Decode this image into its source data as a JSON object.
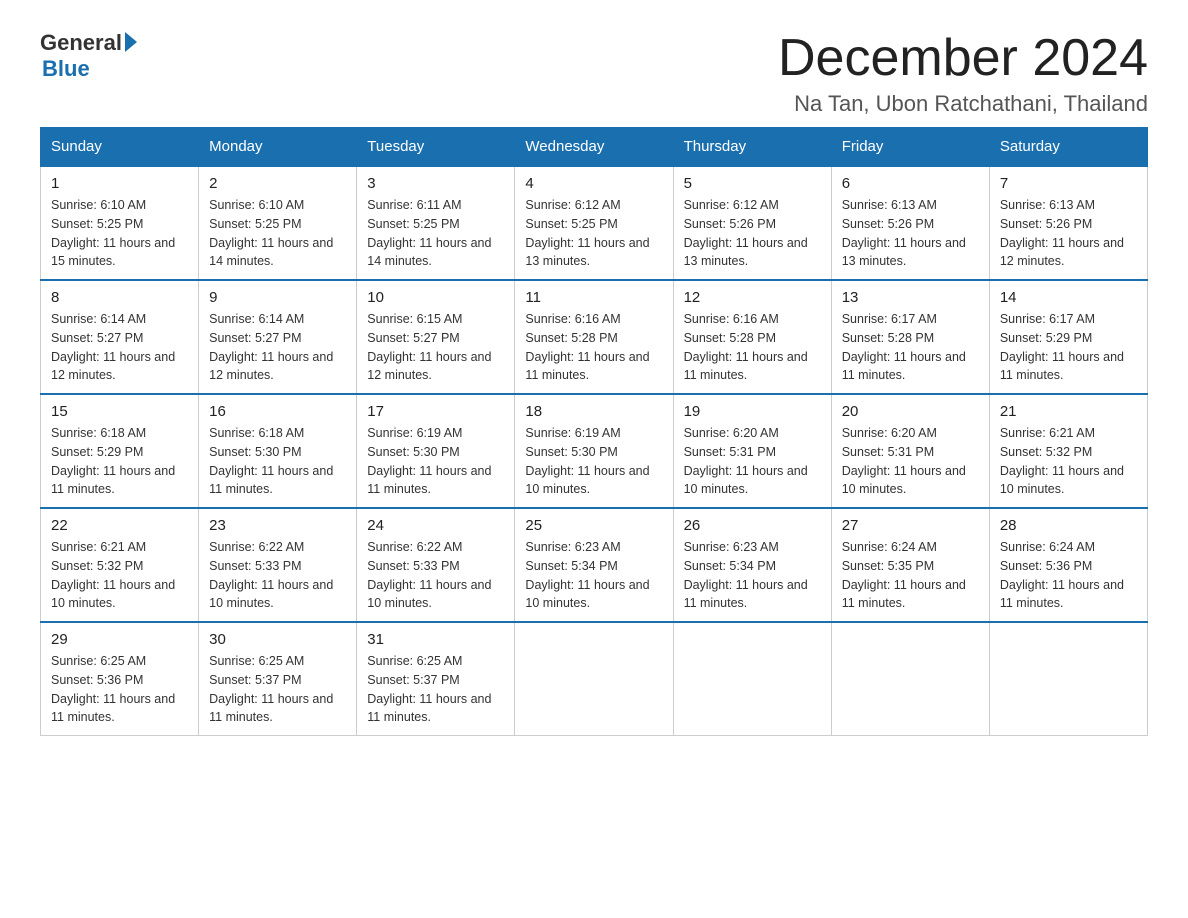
{
  "header": {
    "logo_general": "General",
    "logo_blue": "Blue",
    "month_title": "December 2024",
    "location": "Na Tan, Ubon Ratchathani, Thailand"
  },
  "weekdays": [
    "Sunday",
    "Monday",
    "Tuesday",
    "Wednesday",
    "Thursday",
    "Friday",
    "Saturday"
  ],
  "weeks": [
    [
      {
        "day": "1",
        "sunrise": "6:10 AM",
        "sunset": "5:25 PM",
        "daylight": "11 hours and 15 minutes."
      },
      {
        "day": "2",
        "sunrise": "6:10 AM",
        "sunset": "5:25 PM",
        "daylight": "11 hours and 14 minutes."
      },
      {
        "day": "3",
        "sunrise": "6:11 AM",
        "sunset": "5:25 PM",
        "daylight": "11 hours and 14 minutes."
      },
      {
        "day": "4",
        "sunrise": "6:12 AM",
        "sunset": "5:25 PM",
        "daylight": "11 hours and 13 minutes."
      },
      {
        "day": "5",
        "sunrise": "6:12 AM",
        "sunset": "5:26 PM",
        "daylight": "11 hours and 13 minutes."
      },
      {
        "day": "6",
        "sunrise": "6:13 AM",
        "sunset": "5:26 PM",
        "daylight": "11 hours and 13 minutes."
      },
      {
        "day": "7",
        "sunrise": "6:13 AM",
        "sunset": "5:26 PM",
        "daylight": "11 hours and 12 minutes."
      }
    ],
    [
      {
        "day": "8",
        "sunrise": "6:14 AM",
        "sunset": "5:27 PM",
        "daylight": "11 hours and 12 minutes."
      },
      {
        "day": "9",
        "sunrise": "6:14 AM",
        "sunset": "5:27 PM",
        "daylight": "11 hours and 12 minutes."
      },
      {
        "day": "10",
        "sunrise": "6:15 AM",
        "sunset": "5:27 PM",
        "daylight": "11 hours and 12 minutes."
      },
      {
        "day": "11",
        "sunrise": "6:16 AM",
        "sunset": "5:28 PM",
        "daylight": "11 hours and 11 minutes."
      },
      {
        "day": "12",
        "sunrise": "6:16 AM",
        "sunset": "5:28 PM",
        "daylight": "11 hours and 11 minutes."
      },
      {
        "day": "13",
        "sunrise": "6:17 AM",
        "sunset": "5:28 PM",
        "daylight": "11 hours and 11 minutes."
      },
      {
        "day": "14",
        "sunrise": "6:17 AM",
        "sunset": "5:29 PM",
        "daylight": "11 hours and 11 minutes."
      }
    ],
    [
      {
        "day": "15",
        "sunrise": "6:18 AM",
        "sunset": "5:29 PM",
        "daylight": "11 hours and 11 minutes."
      },
      {
        "day": "16",
        "sunrise": "6:18 AM",
        "sunset": "5:30 PM",
        "daylight": "11 hours and 11 minutes."
      },
      {
        "day": "17",
        "sunrise": "6:19 AM",
        "sunset": "5:30 PM",
        "daylight": "11 hours and 11 minutes."
      },
      {
        "day": "18",
        "sunrise": "6:19 AM",
        "sunset": "5:30 PM",
        "daylight": "11 hours and 10 minutes."
      },
      {
        "day": "19",
        "sunrise": "6:20 AM",
        "sunset": "5:31 PM",
        "daylight": "11 hours and 10 minutes."
      },
      {
        "day": "20",
        "sunrise": "6:20 AM",
        "sunset": "5:31 PM",
        "daylight": "11 hours and 10 minutes."
      },
      {
        "day": "21",
        "sunrise": "6:21 AM",
        "sunset": "5:32 PM",
        "daylight": "11 hours and 10 minutes."
      }
    ],
    [
      {
        "day": "22",
        "sunrise": "6:21 AM",
        "sunset": "5:32 PM",
        "daylight": "11 hours and 10 minutes."
      },
      {
        "day": "23",
        "sunrise": "6:22 AM",
        "sunset": "5:33 PM",
        "daylight": "11 hours and 10 minutes."
      },
      {
        "day": "24",
        "sunrise": "6:22 AM",
        "sunset": "5:33 PM",
        "daylight": "11 hours and 10 minutes."
      },
      {
        "day": "25",
        "sunrise": "6:23 AM",
        "sunset": "5:34 PM",
        "daylight": "11 hours and 10 minutes."
      },
      {
        "day": "26",
        "sunrise": "6:23 AM",
        "sunset": "5:34 PM",
        "daylight": "11 hours and 11 minutes."
      },
      {
        "day": "27",
        "sunrise": "6:24 AM",
        "sunset": "5:35 PM",
        "daylight": "11 hours and 11 minutes."
      },
      {
        "day": "28",
        "sunrise": "6:24 AM",
        "sunset": "5:36 PM",
        "daylight": "11 hours and 11 minutes."
      }
    ],
    [
      {
        "day": "29",
        "sunrise": "6:25 AM",
        "sunset": "5:36 PM",
        "daylight": "11 hours and 11 minutes."
      },
      {
        "day": "30",
        "sunrise": "6:25 AM",
        "sunset": "5:37 PM",
        "daylight": "11 hours and 11 minutes."
      },
      {
        "day": "31",
        "sunrise": "6:25 AM",
        "sunset": "5:37 PM",
        "daylight": "11 hours and 11 minutes."
      },
      null,
      null,
      null,
      null
    ]
  ]
}
